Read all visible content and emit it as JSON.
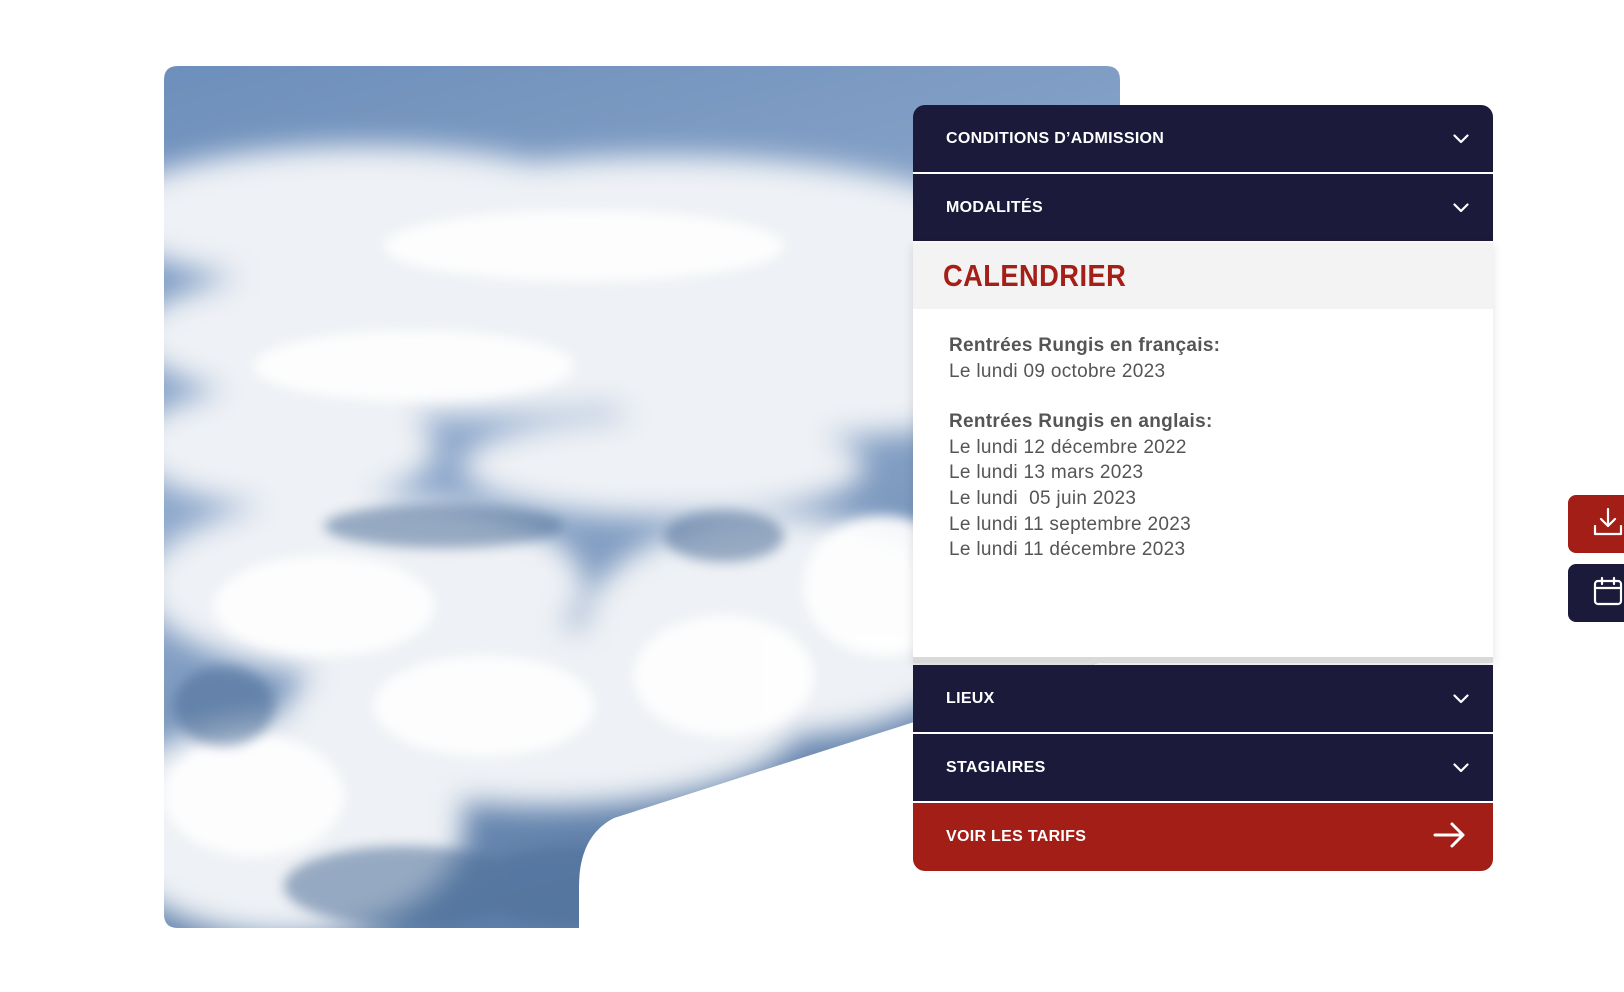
{
  "accordion": {
    "items_top": [
      {
        "label": "CONDITIONS D’ADMISSION",
        "icon": "chevron-down-icon"
      },
      {
        "label": "MODALITÉS",
        "icon": "chevron-down-icon"
      }
    ],
    "calendar": {
      "title": "CALENDRIER",
      "groups": [
        {
          "heading": "Rentrées Rungis en français:",
          "dates": [
            "Le lundi 09 octobre 2023"
          ]
        },
        {
          "heading": "Rentrées Rungis en anglais:",
          "dates": [
            "Le lundi 12 décembre 2022",
            "Le lundi 13 mars 2023",
            "Le lundi  05 juin 2023",
            "Le lundi 11 septembre 2023",
            "Le lundi 11 décembre 2023"
          ]
        }
      ]
    },
    "items_bottom": [
      {
        "label": "LIEUX",
        "icon": "chevron-down-icon"
      },
      {
        "label": "STAGIAIRES",
        "icon": "chevron-down-icon"
      }
    ],
    "cta": {
      "label": "VOIR LES TARIFS",
      "icon": "arrow-right-icon"
    }
  },
  "side_buttons": [
    {
      "icon": "download-icon"
    },
    {
      "icon": "calendar-icon"
    }
  ],
  "colors": {
    "navy": "#1b1a3a",
    "red": "#a21e16",
    "title_red": "#a31f17",
    "text_gray": "#555555"
  }
}
